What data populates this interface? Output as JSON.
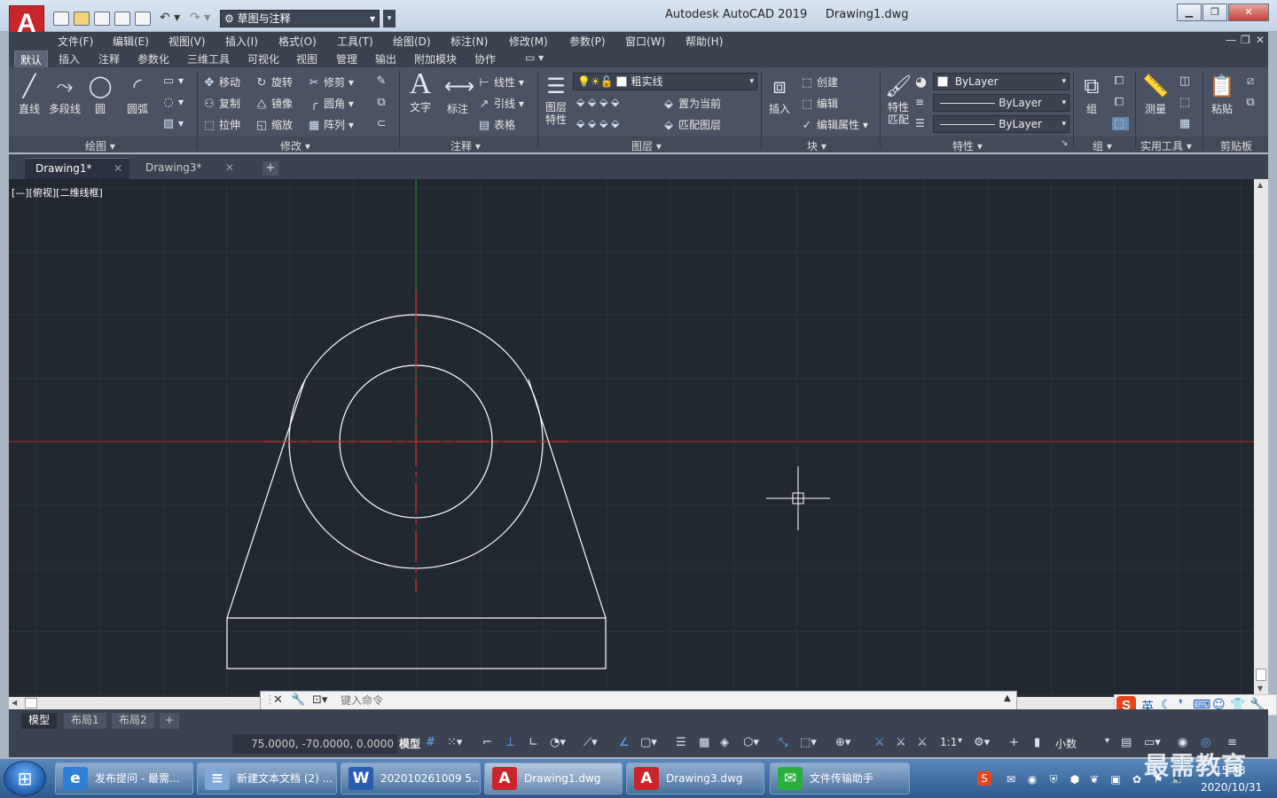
{
  "app": {
    "logo": "A",
    "title": "Autodesk AutoCAD 2019",
    "doc": "Drawing1.dwg"
  },
  "workspace": "草图与注释",
  "menu": [
    "文件(F)",
    "编辑(E)",
    "视图(V)",
    "插入(I)",
    "格式(O)",
    "工具(T)",
    "绘图(D)",
    "标注(N)",
    "修改(M)",
    "参数(P)",
    "窗口(W)",
    "帮助(H)"
  ],
  "ribbon_tabs": [
    "默认",
    "插入",
    "注释",
    "参数化",
    "三维工具",
    "可视化",
    "视图",
    "管理",
    "输出",
    "附加模块",
    "协作"
  ],
  "ribbon": {
    "draw": {
      "title": "绘图",
      "line": "直线",
      "polyline": "多段线",
      "circle": "圆",
      "arc": "圆弧"
    },
    "modify": {
      "title": "修改",
      "move": "移动",
      "rotate": "旋转",
      "trim": "修剪",
      "copy": "复制",
      "mirror": "镜像",
      "fillet": "圆角",
      "stretch": "拉伸",
      "scale": "缩放",
      "array": "阵列"
    },
    "annotation": {
      "title": "注释",
      "text": "文字",
      "dimension": "标注",
      "linear": "线性",
      "leader": "引线",
      "table": "表格"
    },
    "layers": {
      "title": "图层",
      "layer_props_1": "图层",
      "layer_props_2": "特性",
      "current_layer": "粗实线",
      "set_current": "置为当前",
      "match_layer": "匹配图层"
    },
    "block": {
      "title": "块",
      "insert": "插入",
      "create": "创建",
      "edit": "编辑",
      "edit_attr": "编辑属性"
    },
    "properties": {
      "title": "特性",
      "match_1": "特性",
      "match_2": "匹配",
      "color": "ByLayer",
      "linetype": "ByLayer",
      "lineweight": "ByLayer"
    },
    "groups": {
      "title": "组",
      "group": "组"
    },
    "utilities": {
      "title": "实用工具",
      "measure": "测量"
    },
    "clipboard": {
      "title": "剪贴板",
      "paste": "粘贴"
    }
  },
  "file_tabs": [
    {
      "label": "Drawing1*"
    },
    {
      "label": "Drawing3*"
    }
  ],
  "view_label": "[—][俯视][二维线框]",
  "command": {
    "placeholder": "键入命令"
  },
  "layout_tabs": [
    "模型",
    "布局1",
    "布局2"
  ],
  "status": {
    "coords": "75.0000, -70.0000, 0.0000",
    "model": "模型",
    "scale": "1:1",
    "units": "小数"
  },
  "ime": {
    "lang": "英"
  },
  "taskbar": [
    {
      "label": "发布提问 - 最需...",
      "icon": "ie-icon",
      "color": "#2f7fd6",
      "glyph": "e"
    },
    {
      "label": "新建文本文档 (2) ...",
      "icon": "notepad-icon",
      "color": "#7fa8d6",
      "glyph": "≡"
    },
    {
      "label": "202010261009 5...",
      "icon": "word-icon",
      "color": "#2a5db0",
      "glyph": "W"
    },
    {
      "label": "Drawing1.dwg",
      "icon": "autocad-icon",
      "color": "#c8262a",
      "glyph": "A"
    },
    {
      "label": "Drawing3.dwg",
      "icon": "autocad-icon",
      "color": "#c8262a",
      "glyph": "A"
    },
    {
      "label": "文件传输助手",
      "icon": "wechat-icon",
      "color": "#2aae3e",
      "glyph": "✉"
    }
  ],
  "clock": {
    "time": "15:33",
    "date": "2020/10/31"
  },
  "watermark": "最需教育",
  "colors": {
    "canvas": "#212830",
    "axis_x": "#c0262a",
    "axis_y": "#1f8a2e",
    "geometry": "#ffffff",
    "centerline": "#e0252a"
  }
}
